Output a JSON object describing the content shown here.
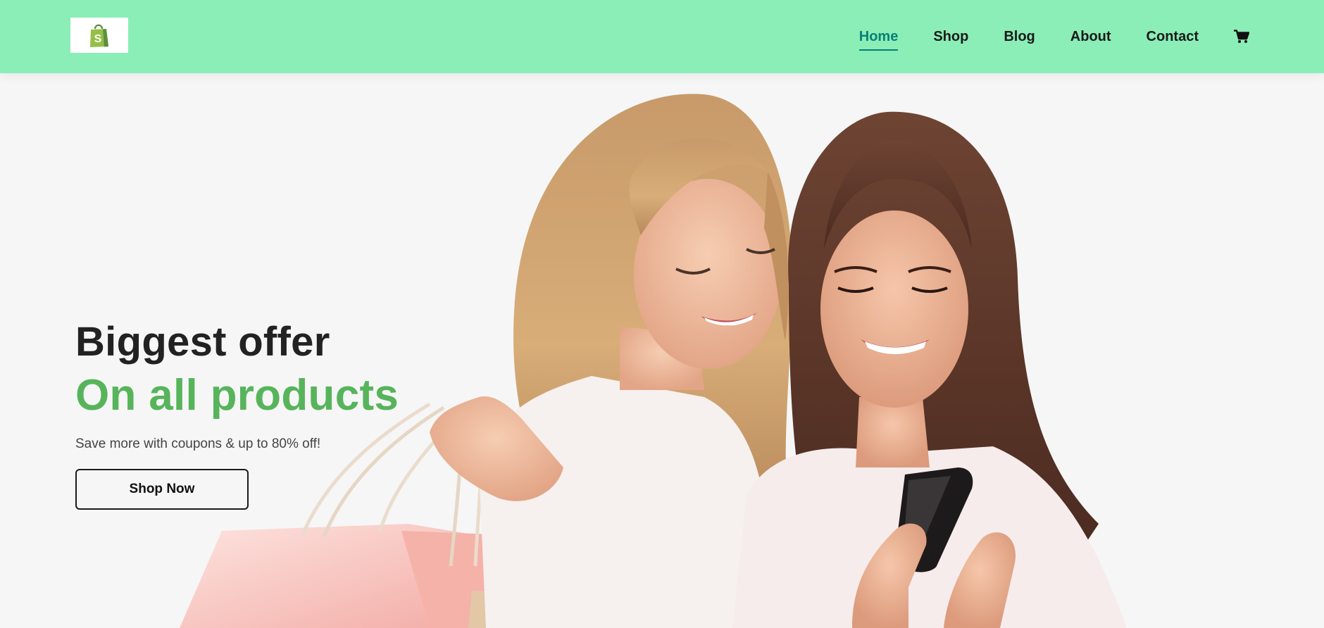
{
  "header": {
    "logo_icon": "shopping-bag-logo",
    "nav": [
      {
        "label": "Home",
        "active": true
      },
      {
        "label": "Shop",
        "active": false
      },
      {
        "label": "Blog",
        "active": false
      },
      {
        "label": "About",
        "active": false
      },
      {
        "label": "Contact",
        "active": false
      }
    ],
    "cart_icon": "cart-icon"
  },
  "hero": {
    "title": "Biggest offer",
    "subtitle": "On all products",
    "description": "Save more with coupons & up to 80% off!",
    "button_label": "Shop Now",
    "image": "two-women-shopping-photo"
  },
  "colors": {
    "header_bg": "#8beeb7",
    "accent": "#088178",
    "highlight": "#57b45b",
    "page_bg": "#f6f6f6"
  }
}
